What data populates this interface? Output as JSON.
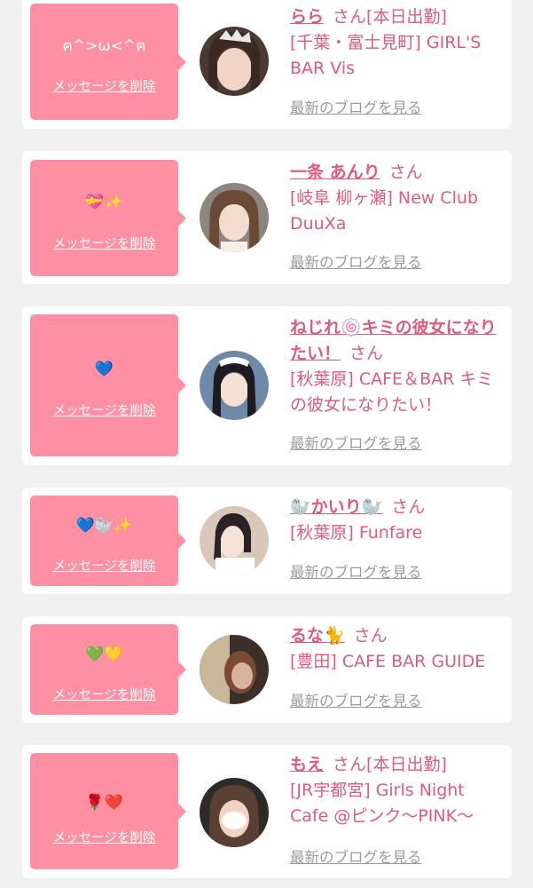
{
  "common": {
    "delete_label": "メッセージを削除",
    "blog_label": "最新のブログを見る",
    "honorific": "さん"
  },
  "colors": {
    "page_background": "#f0f0f0",
    "card_background": "#ffffff",
    "bubble_pink": "#ff90a3",
    "name_pink": "#e05a7a",
    "link_gray": "#9a9a9a"
  },
  "entries": [
    {
      "message": "ฅ^>ω<^ฅ",
      "name": "らら",
      "status": "[本日出勤]",
      "shop": "[千葉・富士見町] GIRL'S BAR Vis"
    },
    {
      "message": "💝✨",
      "name": "一条 あんり",
      "status": "",
      "shop": "[岐阜 柳ヶ瀬] New Club DuuXa"
    },
    {
      "message": "💙",
      "name": "ねじれ🍥キミの彼女になりたい！",
      "status": "",
      "shop": "[秋葉原] CAFE＆BAR キミの彼女になりたい！"
    },
    {
      "message": "💙🦭✨",
      "name": "🦭かいり🦭",
      "status": "",
      "shop": "[秋葉原] Funfare"
    },
    {
      "message": "💚💛",
      "name": "るな🐈",
      "status": "",
      "shop": "[豊田] CAFE BAR GUIDE"
    },
    {
      "message": "🌹❤️",
      "name": "もえ",
      "status": "[本日出勤]",
      "shop": "[JR宇都宮] Girls Night Cafe @ピンク～PINK～"
    }
  ]
}
